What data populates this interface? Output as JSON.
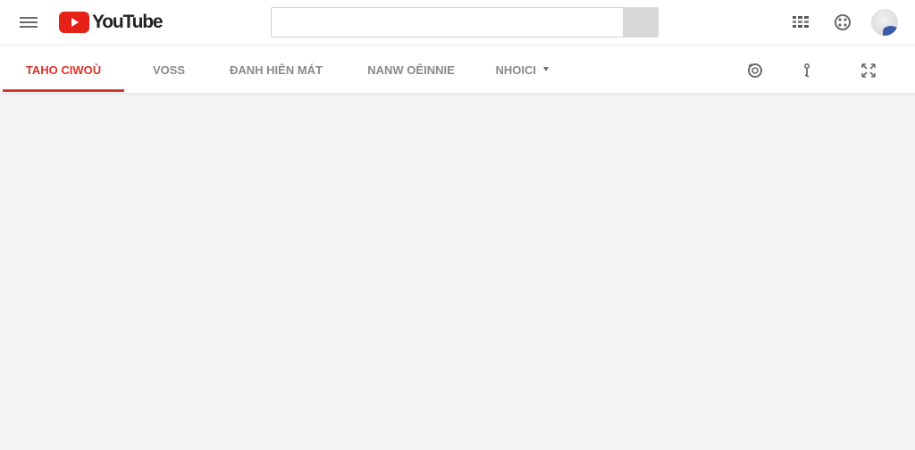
{
  "header": {
    "logo_text": "YouTube",
    "search": {
      "value": "",
      "placeholder": ""
    },
    "icons": {
      "menu": "menu-icon",
      "upload": "upload-icon",
      "apps": "apps-icon",
      "avatar": "avatar"
    }
  },
  "tabs": {
    "items": [
      {
        "label": "TAHO CIWOÙ",
        "active": true
      },
      {
        "label": "VOSS"
      },
      {
        "label": "ĐANH HIÊN MÁT"
      },
      {
        "label": "NANW OÊINNIE"
      },
      {
        "label": "NHOICI",
        "has_dropdown": true
      }
    ],
    "right_icons": [
      "refresh-icon",
      "info-icon",
      "fullscreen-icon"
    ]
  },
  "colors": {
    "brand_red": "#e62117",
    "active_tab": "#d9342b",
    "tab_text": "#8a8a8a",
    "content_bg": "#f3f3f3"
  }
}
